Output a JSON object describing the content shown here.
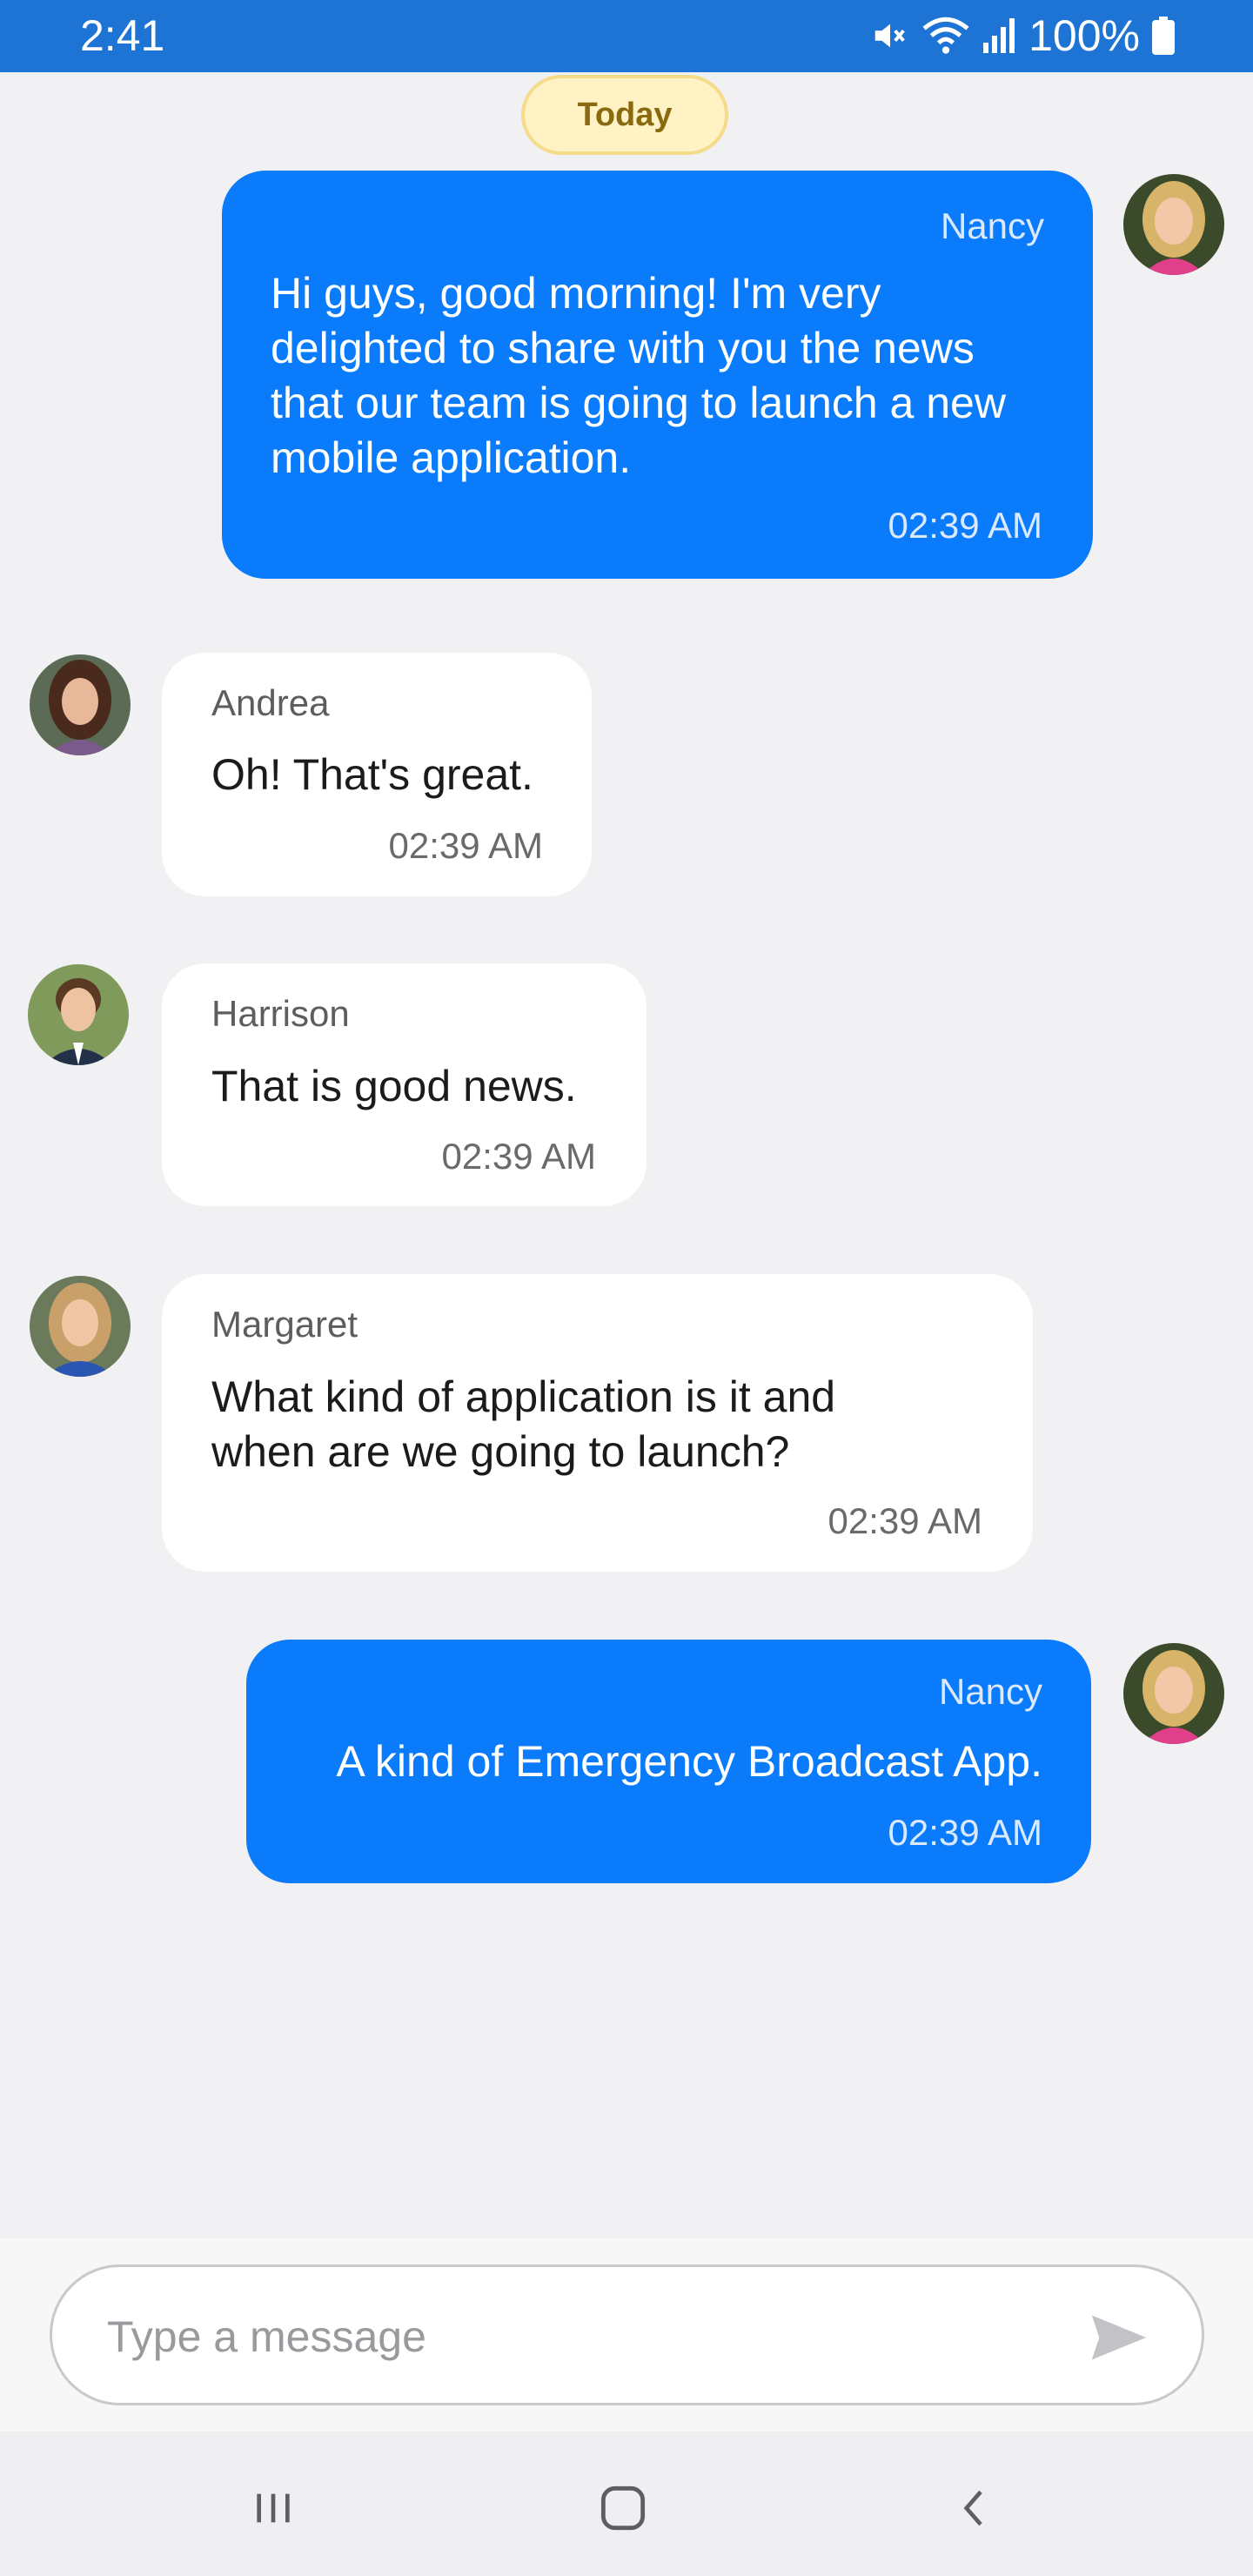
{
  "status_bar": {
    "time": "2:41",
    "battery": "100%",
    "icons": [
      "mute-icon",
      "wifi-icon",
      "signal-icon",
      "battery-icon"
    ],
    "background_color": "#1d74d4"
  },
  "date_chip": {
    "label": "Today"
  },
  "messages": [
    {
      "sender": "Nancy",
      "text": "Hi guys, good morning! I'm very delighted to share with you the news that our team is going to launch a new mobile application.",
      "time": "02:39 AM",
      "direction": "outgoing"
    },
    {
      "sender": "Andrea",
      "text": "Oh! That's great.",
      "time": "02:39 AM",
      "direction": "incoming"
    },
    {
      "sender": "Harrison",
      "text": "That is good news.",
      "time": "02:39 AM",
      "direction": "incoming"
    },
    {
      "sender": "Margaret",
      "text": "What kind of application is it and when are we going to launch?",
      "time": "02:39 AM",
      "direction": "incoming"
    },
    {
      "sender": "Nancy",
      "text": "A kind of Emergency Broadcast App.",
      "time": "02:39 AM",
      "direction": "outgoing"
    }
  ],
  "composer": {
    "placeholder": "Type a message",
    "value": ""
  },
  "colors": {
    "outgoing_bubble": "#0a7bfa",
    "incoming_bubble": "#ffffff",
    "chat_background": "#f1f1f3"
  }
}
